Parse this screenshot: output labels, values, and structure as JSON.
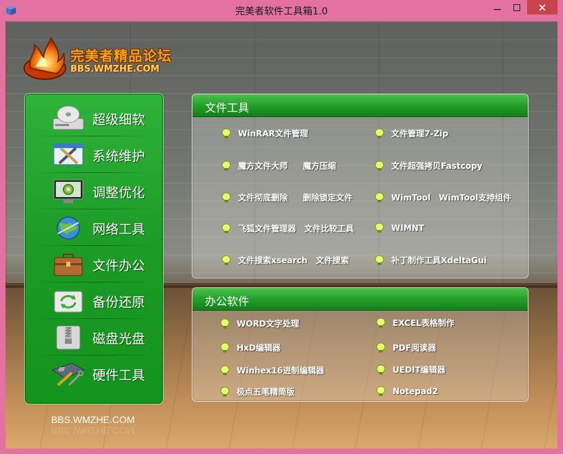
{
  "window": {
    "title": "完美者软件工具箱1.0"
  },
  "logo": {
    "name": "完美者精品论坛",
    "site": "BBS.WMZHE.COM"
  },
  "sidebar": {
    "items": [
      {
        "label": "超级细软",
        "icon": "disk-drive-icon"
      },
      {
        "label": "系统维护",
        "icon": "tools-window-icon"
      },
      {
        "label": "调整优化",
        "icon": "gear-monitor-icon"
      },
      {
        "label": "网络工具",
        "icon": "globe-icon"
      },
      {
        "label": "文件办公",
        "icon": "briefcase-icon"
      },
      {
        "label": "备份还原",
        "icon": "backup-restore-icon"
      },
      {
        "label": "磁盘光盘",
        "icon": "zip-disk-icon"
      },
      {
        "label": "硬件工具",
        "icon": "motherboard-tools-icon"
      }
    ]
  },
  "footer": {
    "site": "BBS.WMZHE.COM"
  },
  "panels": {
    "file_tools": {
      "title": "文件工具",
      "items": [
        {
          "label": "WinRAR文件管理"
        },
        {
          "label": "文件管理7-Zip"
        },
        {
          "label": "魔方文件大师",
          "extra": "魔方压缩"
        },
        {
          "label": "文件超强拷贝Fastcopy"
        },
        {
          "label": "文件彻底删除",
          "extra": "删除锁定文件"
        },
        {
          "label": "WimTool",
          "extra": "WimTool支持组件"
        },
        {
          "label": "飞狐文件管理器",
          "extra": "文件比较工具"
        },
        {
          "label": "WIMNT"
        },
        {
          "label": "文件搜索xsearch",
          "extra": "文件搜索"
        },
        {
          "label": "补丁制作工具XdeltaGui"
        }
      ]
    },
    "office": {
      "title": "办公软件",
      "items": [
        {
          "label": "WORD文字处理"
        },
        {
          "label": "EXCEL表格制作"
        },
        {
          "label": "HxD编辑器"
        },
        {
          "label": "PDF阅读器"
        },
        {
          "label": "Winhex16进制编辑器"
        },
        {
          "label": "UEDIT编辑器"
        },
        {
          "label": "极点五笔精简版"
        },
        {
          "label": "Notepad2"
        }
      ]
    }
  },
  "colors": {
    "accent_green": "#1c9b26",
    "title_bar": "#e472a0",
    "close_red": "#c7444a"
  }
}
